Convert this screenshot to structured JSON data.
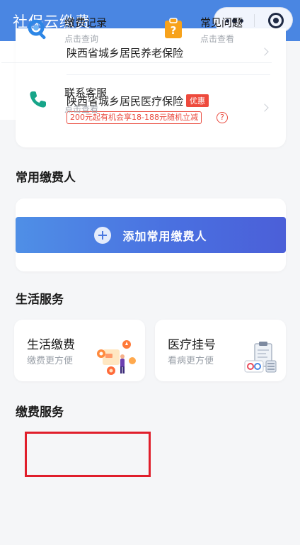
{
  "nav": {
    "title": "社保云缴费"
  },
  "insurance": {
    "items": [
      {
        "label": "陕西省城乡居民养老保险"
      },
      {
        "label": "陕西省城乡居民医疗保险",
        "badge": "优惠",
        "promo": "200元起有机会享18-188元随机立减"
      }
    ]
  },
  "payer": {
    "section_title": "常用缴费人",
    "add_button": "添加常用缴费人"
  },
  "life": {
    "section_title": "生活服务",
    "cards": [
      {
        "title": "生活缴费",
        "subtitle": "缴费更方便"
      },
      {
        "title": "医疗挂号",
        "subtitle": "看病更方便"
      }
    ]
  },
  "pay_services": {
    "section_title": "缴费服务",
    "items": [
      {
        "title": "缴费记录",
        "subtitle": "点击查询"
      },
      {
        "title": "常见问题",
        "subtitle": "点击查看"
      },
      {
        "title": "联系客服",
        "subtitle": "点击查看"
      }
    ]
  },
  "colors": {
    "brand": "#4a86e2",
    "accent_red": "#ee4a3d",
    "highlight": "#e01e2b"
  }
}
